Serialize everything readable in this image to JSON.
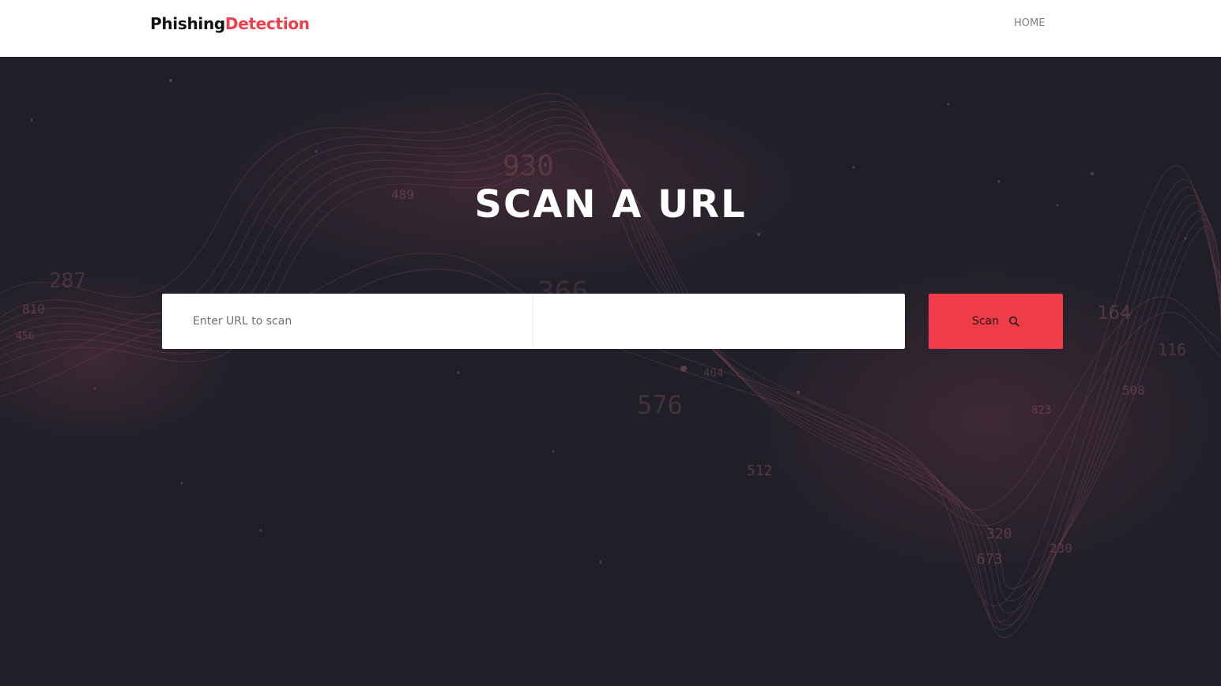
{
  "brand": {
    "name_part1": "Phishing",
    "name_part2": "Detection",
    "accent_color": "#ef3e4a"
  },
  "nav": {
    "items": [
      {
        "label": "HOME"
      }
    ]
  },
  "hero": {
    "title": "SCAN A URL",
    "background_color": "#1e1f27",
    "background_numbers": [
      "930",
      "489",
      "287",
      "810",
      "456",
      "366",
      "164",
      "116",
      "576",
      "512",
      "320",
      "230",
      "673",
      "823",
      "508",
      "404"
    ]
  },
  "search": {
    "placeholder": "Enter URL to scan",
    "value": "",
    "button_label": "Scan",
    "button_icon": "search-icon",
    "button_color": "#f03c4a"
  }
}
